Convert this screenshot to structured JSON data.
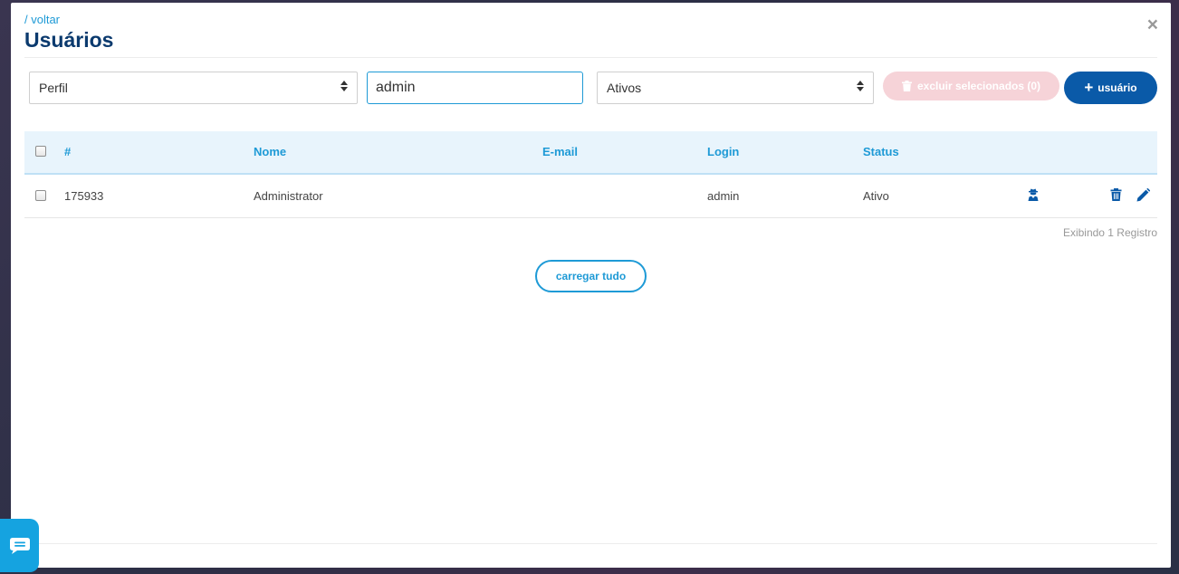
{
  "header": {
    "back_link": "/ voltar",
    "title": "Usuários",
    "close": "×"
  },
  "filters": {
    "profile_select": "Perfil",
    "search_value": "admin",
    "status_select": "Ativos"
  },
  "actions": {
    "delete_selected": "excluir selecionados (0)",
    "add_user": "usuário"
  },
  "table": {
    "columns": [
      "#",
      "Nome",
      "E-mail",
      "Login",
      "Status"
    ],
    "rows": [
      {
        "id": "175933",
        "name": "Administrator",
        "email": "",
        "login": "admin",
        "status": "Ativo"
      }
    ]
  },
  "footer": {
    "count": "Exibindo 1 Registro",
    "load_all": "carregar tudo"
  },
  "colors": {
    "accent": "#1e9ad6",
    "title": "#0b3a6e",
    "primary_button": "#0a5aa8",
    "danger_disabled": "#f6d3d8"
  }
}
